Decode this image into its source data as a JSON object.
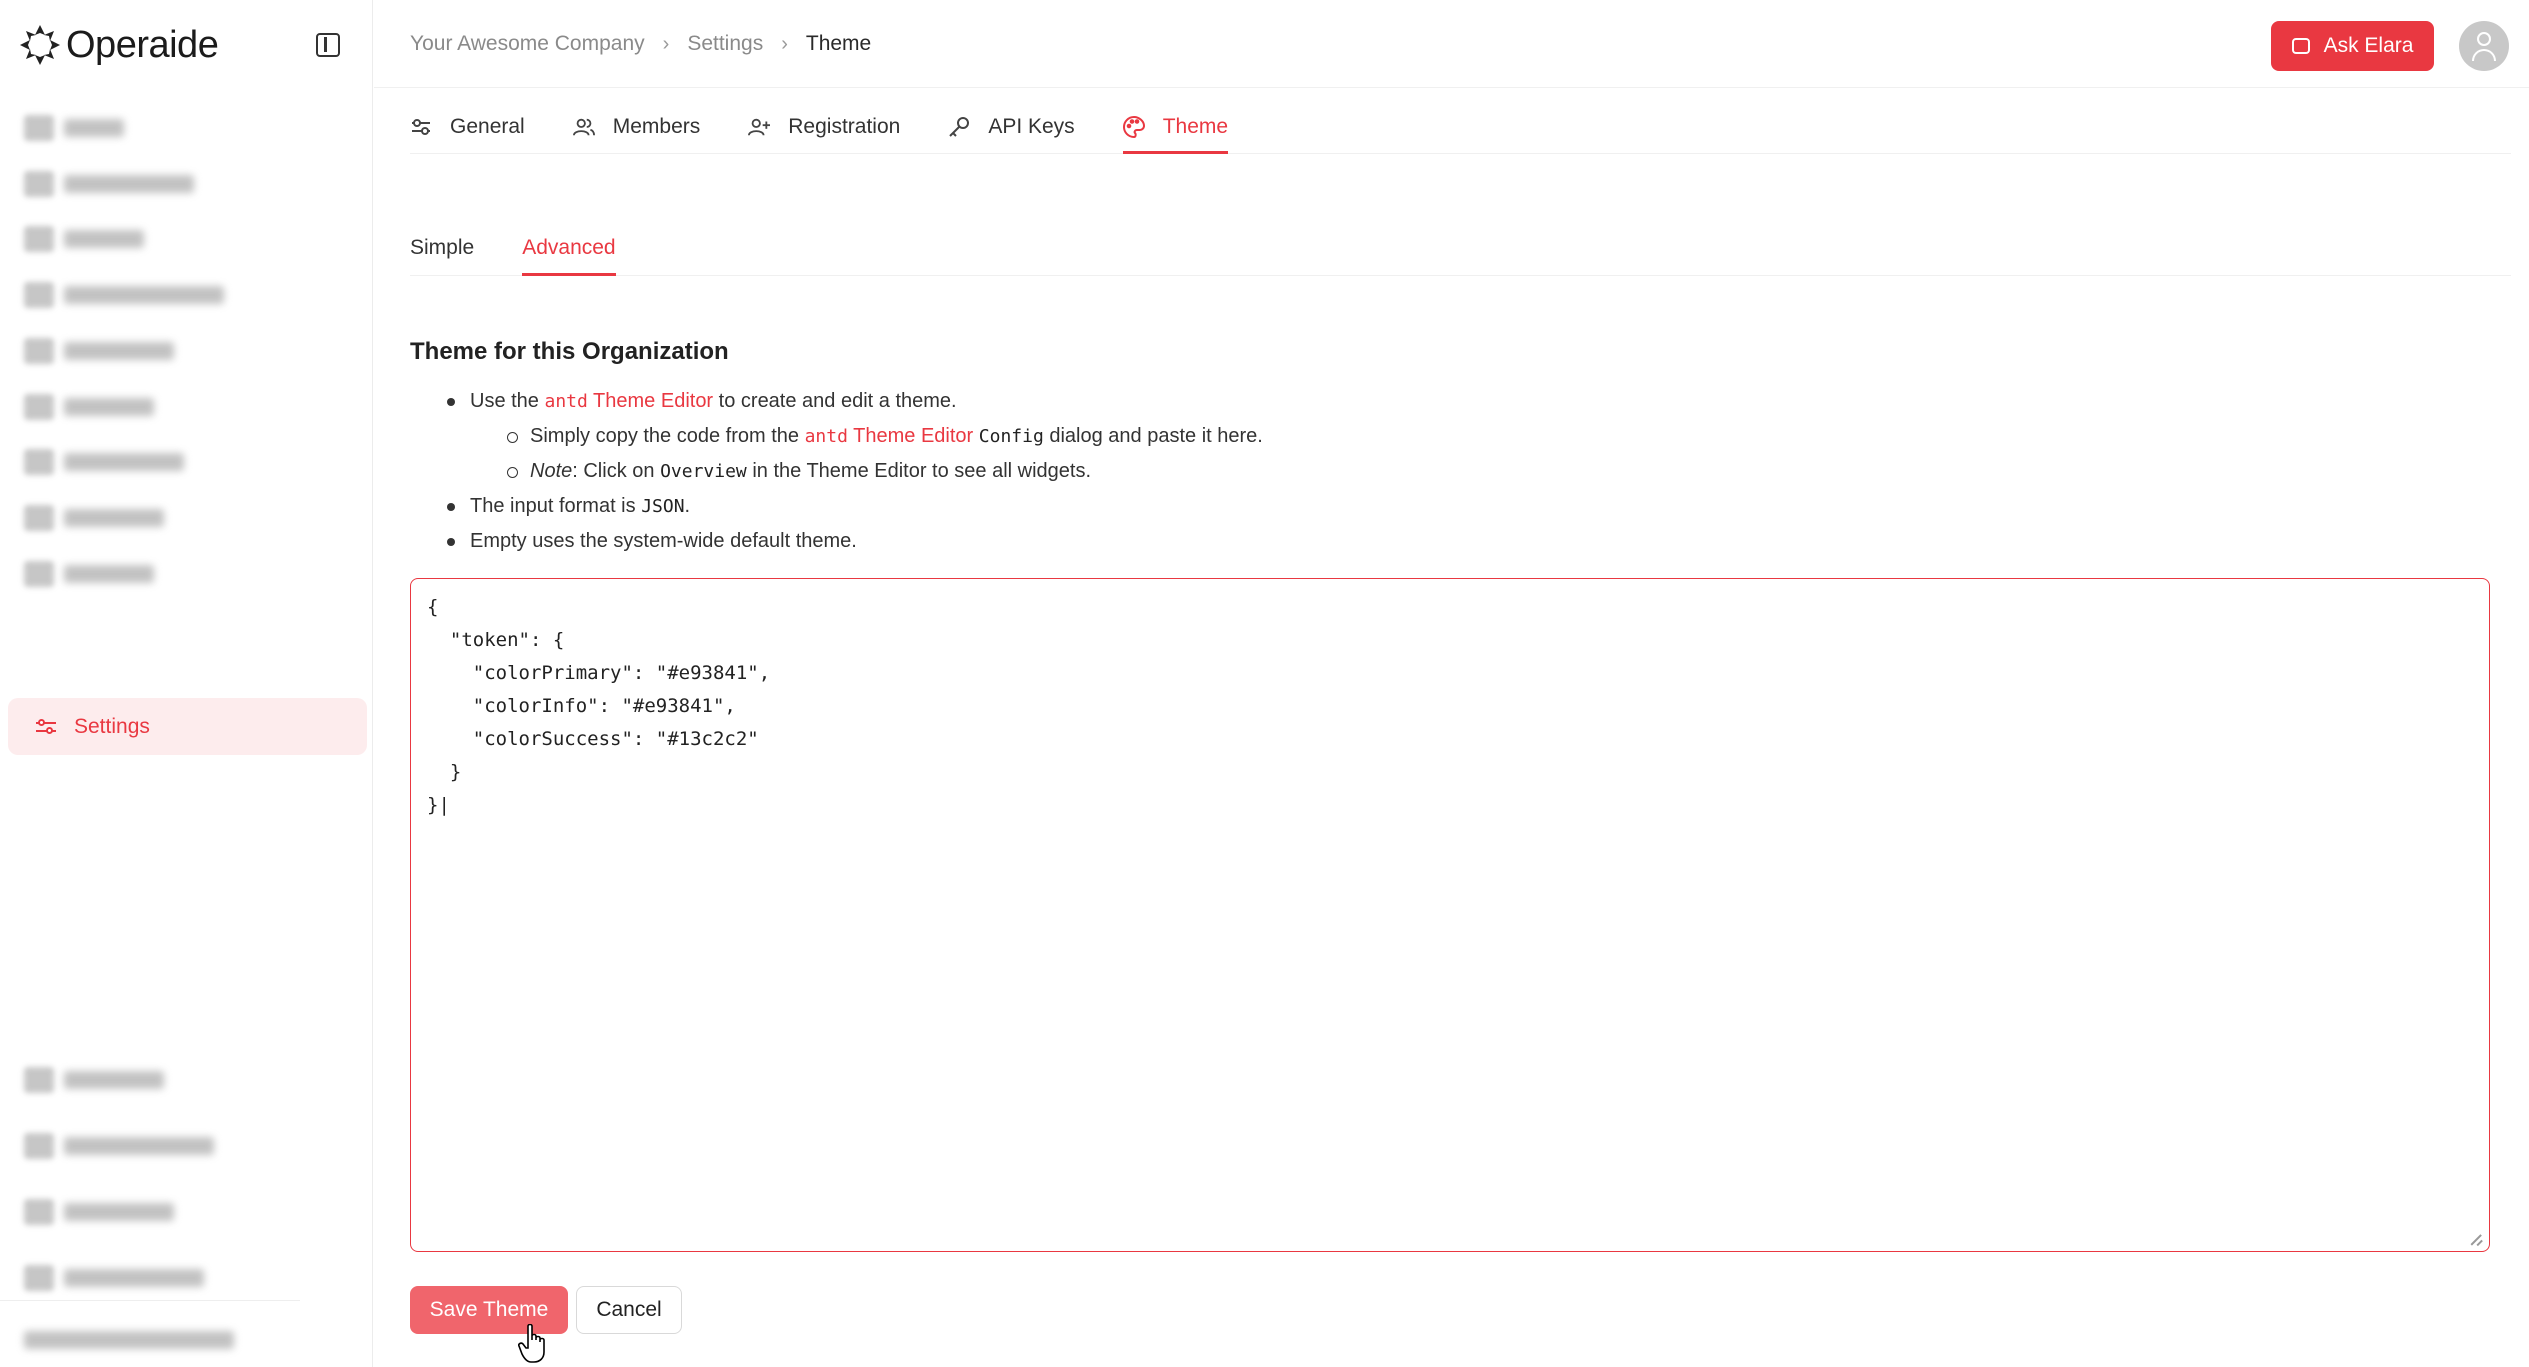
{
  "app": {
    "name": "Operaide"
  },
  "sidebar": {
    "blurred_items": [
      {
        "w": 60
      },
      {
        "w": 130
      },
      {
        "w": 80
      },
      {
        "w": 160
      },
      {
        "w": 110
      },
      {
        "w": 90
      },
      {
        "w": 120
      },
      {
        "w": 100
      },
      {
        "w": 90
      }
    ],
    "active_item": {
      "label": "Settings"
    },
    "bottom_blurred_items": [
      {
        "w": 100
      },
      {
        "w": 150
      },
      {
        "w": 110
      },
      {
        "w": 140
      }
    ],
    "footer_blurred": {
      "w": 210
    }
  },
  "header": {
    "breadcrumb": [
      "Your Awesome Company",
      "Settings",
      "Theme"
    ],
    "ask_button": "Ask Elara"
  },
  "tabs": [
    {
      "label": "General",
      "icon": "sliders-icon",
      "active": false
    },
    {
      "label": "Members",
      "icon": "users-icon",
      "active": false
    },
    {
      "label": "Registration",
      "icon": "user-plus-icon",
      "active": false
    },
    {
      "label": "API Keys",
      "icon": "key-icon",
      "active": false
    },
    {
      "label": "Theme",
      "icon": "palette-icon",
      "active": true
    }
  ],
  "subtabs": [
    {
      "label": "Simple",
      "active": false
    },
    {
      "label": "Advanced",
      "active": true
    }
  ],
  "content": {
    "title": "Theme for this Organization",
    "bullets": {
      "b1_pre": "Use the ",
      "b1_code": "antd",
      "b1_link": "Theme Editor",
      "b1_post": " to create and edit a theme.",
      "s1_pre": "Simply copy the code from the ",
      "s1_code": "antd",
      "s1_link": "Theme Editor",
      "s1_code2": "Config",
      "s1_post": " dialog and paste it here.",
      "s2_em": "Note",
      "s2_pre": ": Click on ",
      "s2_code": "Overview",
      "s2_post": " in the Theme Editor to see all widgets.",
      "b2_pre": "The input format is ",
      "b2_code": "JSON",
      "b2_post": ".",
      "b3": "Empty uses the system-wide default theme."
    },
    "editor_value": "{\n  \"token\": {\n    \"colorPrimary\": \"#e93841\",\n    \"colorInfo\": \"#e93841\",\n    \"colorSuccess\": \"#13c2c2\"\n  }\n}|"
  },
  "actions": {
    "save": "Save Theme",
    "cancel": "Cancel"
  },
  "colors": {
    "accent": "#e93841",
    "accent_light": "#fdeced"
  }
}
